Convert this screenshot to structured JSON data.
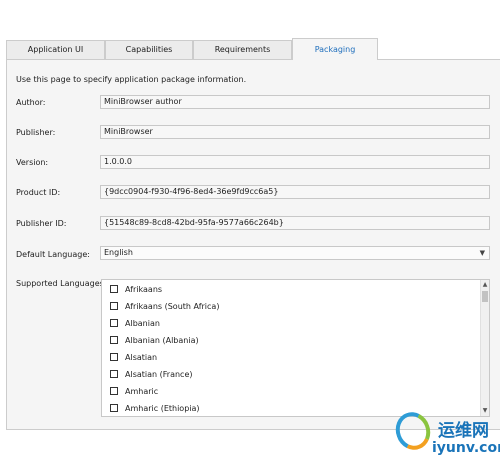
{
  "tabs": [
    {
      "label": "Application UI",
      "active": false
    },
    {
      "label": "Capabilities",
      "active": false
    },
    {
      "label": "Requirements",
      "active": false
    },
    {
      "label": "Packaging",
      "active": true
    }
  ],
  "intro": "Use this page to specify application package information.",
  "fields": {
    "author": {
      "label": "Author:",
      "value": "MiniBrowser author"
    },
    "publisher": {
      "label": "Publisher:",
      "value": "MiniBrowser"
    },
    "version": {
      "label": "Version:",
      "value": "1.0.0.0"
    },
    "product_id": {
      "label": "Product ID:",
      "value": "{9dcc0904-f930-4f96-8ed4-36e9fd9cc6a5}"
    },
    "publisher_id": {
      "label": "Publisher ID:",
      "value": "{51548c89-8cd8-42bd-95fa-9577a66c264b}"
    }
  },
  "default_language": {
    "label": "Default Language:",
    "value": "English",
    "icon": "chevron-down-icon"
  },
  "supported_languages": {
    "label": "Supported Languages:",
    "items": [
      {
        "label": "Afrikaans",
        "checked": false
      },
      {
        "label": "Afrikaans (South Africa)",
        "checked": false
      },
      {
        "label": "Albanian",
        "checked": false
      },
      {
        "label": "Albanian (Albania)",
        "checked": false
      },
      {
        "label": "Alsatian",
        "checked": false
      },
      {
        "label": "Alsatian (France)",
        "checked": false
      },
      {
        "label": "Amharic",
        "checked": false
      },
      {
        "label": "Amharic (Ethiopia)",
        "checked": false
      }
    ]
  },
  "watermark": {
    "chinese": "运维网",
    "url": "iyunv.com"
  },
  "colors": {
    "accent": "#1e6ebc",
    "panel": "#f5f5f5",
    "watermark": "#1a74b9"
  }
}
